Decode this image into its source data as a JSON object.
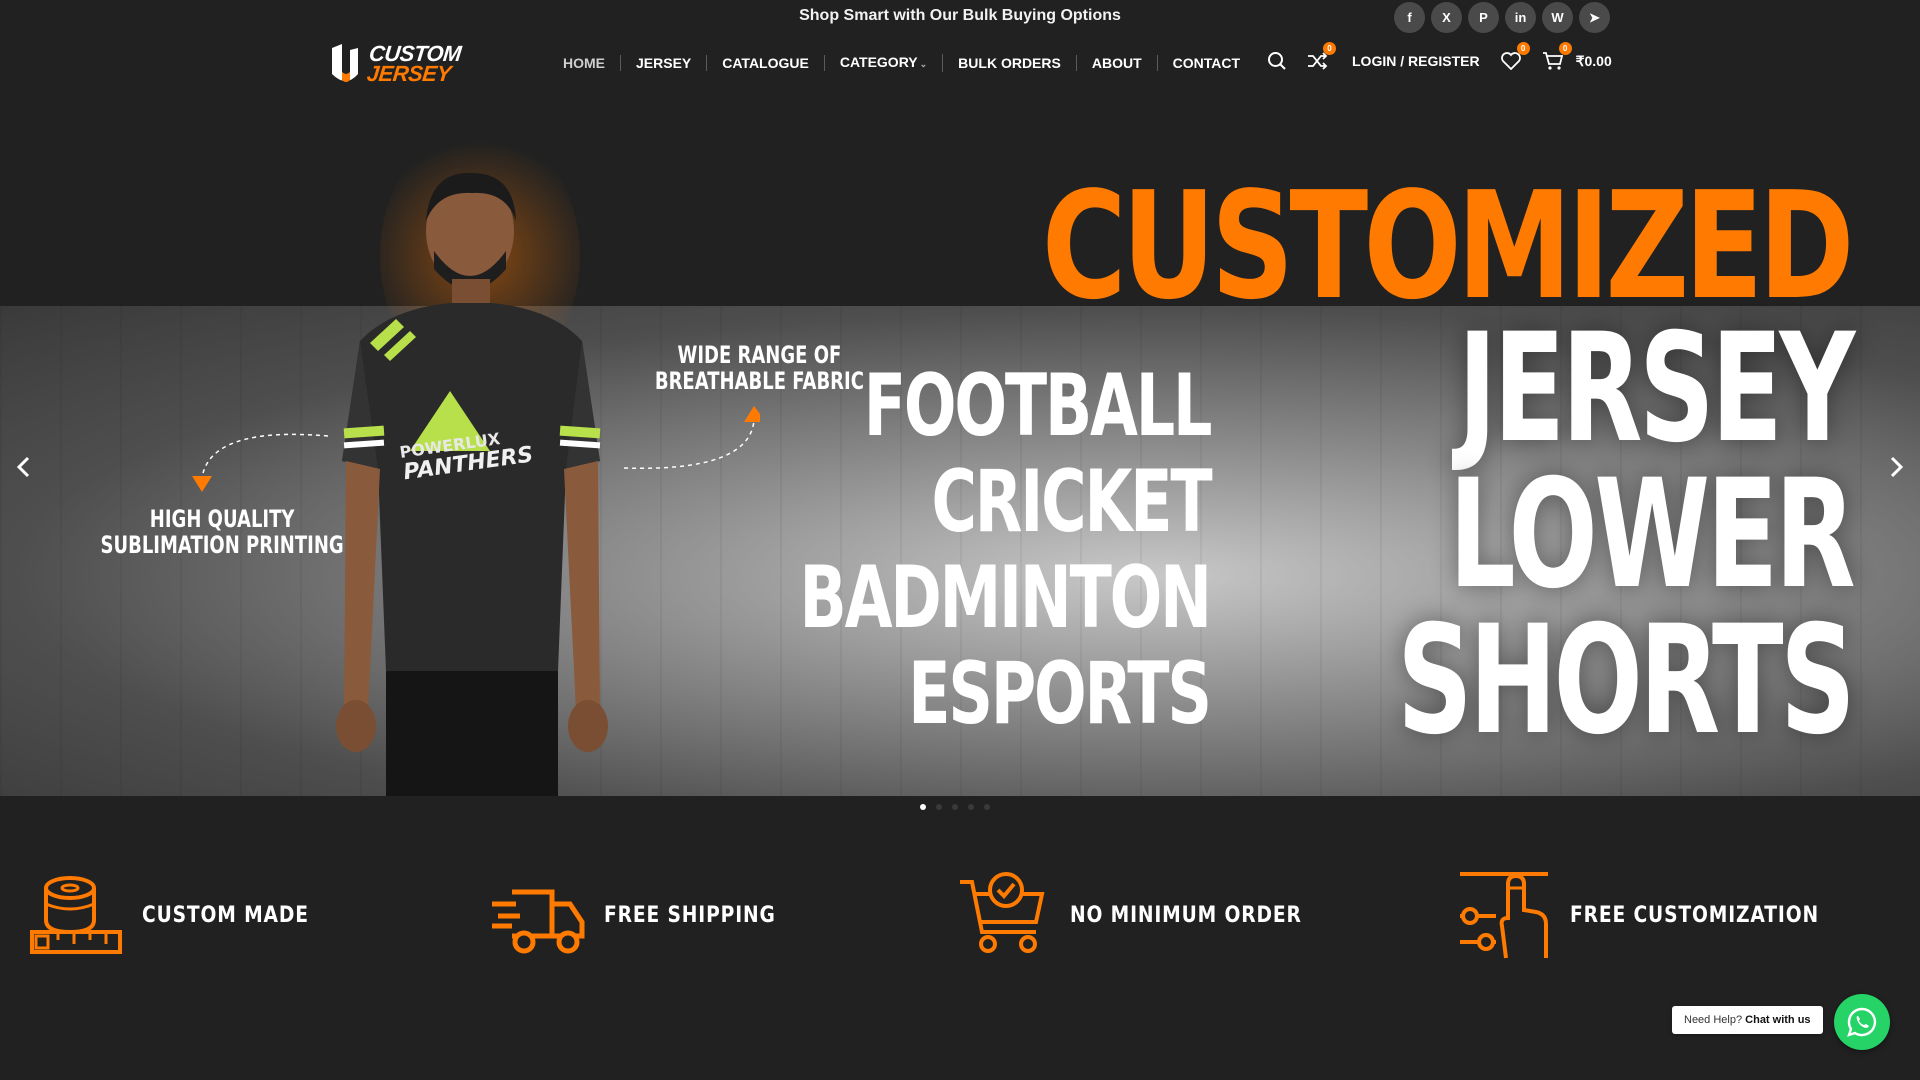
{
  "topbar": {
    "promo": "Shop Smart with Our Bulk Buying Options",
    "socials": [
      {
        "name": "facebook-icon",
        "glyph": "f"
      },
      {
        "name": "x-twitter-icon",
        "glyph": "X"
      },
      {
        "name": "pinterest-icon",
        "glyph": "P"
      },
      {
        "name": "linkedin-icon",
        "glyph": "in"
      },
      {
        "name": "whatsapp-icon",
        "glyph": "W"
      },
      {
        "name": "telegram-icon",
        "glyph": "➤"
      }
    ]
  },
  "logo": {
    "line1": "CUSTOM",
    "line2": "JERSEY"
  },
  "nav": {
    "items": [
      "HOME",
      "JERSEY",
      "CATALOGUE",
      "CATEGORY",
      "BULK ORDERS",
      "ABOUT",
      "CONTACT"
    ]
  },
  "header_tools": {
    "compare_count": "0",
    "login_label": "LOGIN / REGISTER",
    "wishlist_count": "0",
    "cart_count": "0",
    "cart_total": "₹0.00"
  },
  "hero": {
    "headline": "CUSTOMIZED",
    "products": [
      "JERSEY",
      "LOWER",
      "SHORTS"
    ],
    "sports": [
      "FOOTBALL",
      "CRICKET",
      "BADMINTON",
      "ESPORTS"
    ],
    "callout_fabric": [
      "WIDE RANGE OF",
      "BREATHABLE FABRIC"
    ],
    "callout_print": [
      "HIGH QUALITY",
      "SUBLIMATION PRINTING"
    ],
    "jersey_text": "POWERLUX PANTHERS",
    "slide_count": 5,
    "active_slide": 1
  },
  "features": [
    {
      "label": "CUSTOM MADE",
      "icon": "measuring-tape-icon"
    },
    {
      "label": "FREE SHIPPING",
      "icon": "delivery-truck-icon"
    },
    {
      "label": "NO MINIMUM ORDER",
      "icon": "shopping-cart-check-icon"
    },
    {
      "label": "FREE CUSTOMIZATION",
      "icon": "hand-sliders-icon"
    }
  ],
  "help": {
    "prefix": "Need Help?",
    "action": "Chat with us"
  },
  "colors": {
    "accent": "#ff7a00",
    "background": "#212121",
    "whatsapp": "#25d366"
  }
}
